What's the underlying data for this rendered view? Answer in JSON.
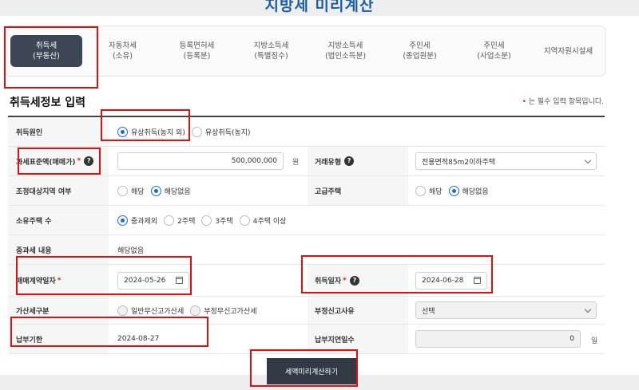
{
  "page_title": "지방세 미리계산",
  "tabs": [
    {
      "label": "취득세\n(부동산)",
      "active": true
    },
    {
      "label": "자동차세\n(소유)"
    },
    {
      "label": "등록면허세\n(등록분)"
    },
    {
      "label": "지방소득세\n(특별징수)"
    },
    {
      "label": "지방소득세\n(법인소득분)"
    },
    {
      "label": "주민세\n(종업원분)"
    },
    {
      "label": "주민세\n(사업소분)"
    },
    {
      "label": "지역자원시설세"
    }
  ],
  "section_title": "취득세정보 입력",
  "required_note": "는 필수 입력 항목입니다.",
  "required_mark": "*",
  "help_glyph": "?",
  "form": {
    "cause": {
      "label": "취득원인",
      "options": [
        "유상취득(농지 외)",
        "유상취득(농지)"
      ],
      "selected": 0
    },
    "tax_base": {
      "label": "과세표준액(매매가)",
      "value": "500,000,000",
      "unit": "원"
    },
    "deal_type": {
      "label": "거래유형",
      "value": "전용면적85m2이하주택"
    },
    "adjust_area": {
      "label": "조정대상지역 여부",
      "options": [
        "해당",
        "해당없음"
      ],
      "selected": 1
    },
    "luxury": {
      "label": "고급주택",
      "options": [
        "해당",
        "해당없음"
      ],
      "selected": 1
    },
    "house_count": {
      "label": "소유주택 수",
      "options": [
        "중과제외",
        "2주택",
        "3주택",
        "4주택 이상"
      ],
      "selected": 0
    },
    "heavy_tax": {
      "label": "중과세 내용",
      "value": "해당없음"
    },
    "contract_date": {
      "label": "매매계약일자",
      "value": "2024-05-26"
    },
    "acquire_date": {
      "label": "취득일자",
      "value": "2024-06-28"
    },
    "penalty_type": {
      "label": "가산세구분",
      "options": [
        "일반무신고가산세",
        "부정무신고가산세"
      ]
    },
    "improper_reason": {
      "label": "부정신고사유",
      "value": "선택"
    },
    "due_date": {
      "label": "납부기한",
      "value": "2024-08-27"
    },
    "late_days": {
      "label": "납부지연일수",
      "value": "0",
      "unit": "일"
    }
  },
  "calc_button": "세액미리계산하기",
  "colors": {
    "accent": "#1a5ea8",
    "active_tab": "#3d4655",
    "highlight": "#e01010",
    "required": "#e02020"
  }
}
